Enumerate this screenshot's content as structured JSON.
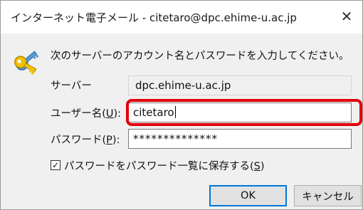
{
  "dialog": {
    "title": "インターネット電子メール - citetaro@dpc.ehime-u.ac.jp",
    "close_glyph": "✕",
    "icon": "key-icon",
    "message": "次のサーバーのアカウント名とパスワードを入力してください。",
    "server": {
      "label": "サーバー",
      "value": "dpc.ehime-u.ac.jp"
    },
    "username": {
      "label_text": "ユーザー名(",
      "accel": "U",
      "label_tail": "):",
      "value": "citetaro"
    },
    "password": {
      "label_text": "パスワード(",
      "accel": "P",
      "label_tail": "):",
      "value": "**************"
    },
    "save_password": {
      "checked": true,
      "check_glyph": "✓",
      "label_text": "パスワードをパスワード一覧に保存する(",
      "accel": "S",
      "label_tail": ")"
    },
    "buttons": {
      "ok": "OK",
      "cancel": "キャンセル"
    },
    "highlight_color": "#e3000b",
    "accent_color": "#0078d7"
  }
}
